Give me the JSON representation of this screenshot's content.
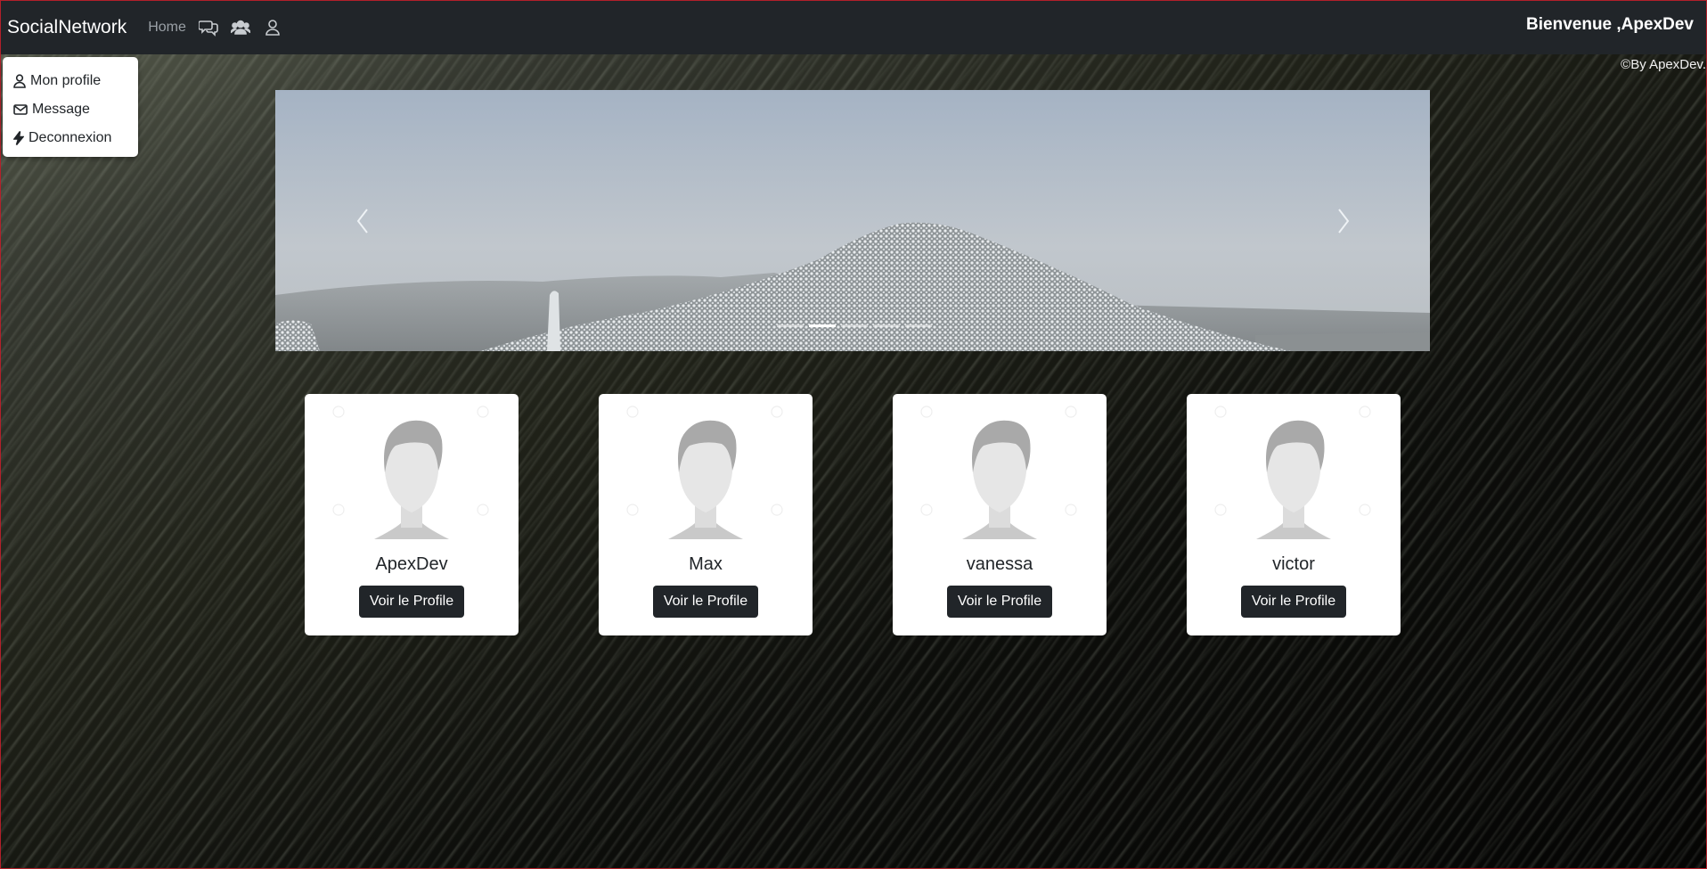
{
  "navbar": {
    "brand": "SocialNetwork",
    "home_label": "Home",
    "icons": [
      "chat-icon",
      "users-icon",
      "user-icon"
    ],
    "welcome": "Bienvenue ,ApexDev"
  },
  "copyright": "©By ApexDev.",
  "dropdown": {
    "items": [
      {
        "label": "Mon profile",
        "icon": "user-icon"
      },
      {
        "label": "Message",
        "icon": "envelope-icon"
      },
      {
        "label": "Deconnexion",
        "icon": "bolt-icon"
      }
    ]
  },
  "carousel": {
    "slide_count": 5,
    "active_index": 1
  },
  "cards": [
    {
      "name": "ApexDev",
      "button": "Voir le Profile"
    },
    {
      "name": "Max",
      "button": "Voir le Profile"
    },
    {
      "name": "vanessa",
      "button": "Voir le Profile"
    },
    {
      "name": "victor",
      "button": "Voir le Profile"
    }
  ],
  "colors": {
    "navbar_bg": "#212529",
    "button_bg": "#212529",
    "card_bg": "#ffffff"
  }
}
